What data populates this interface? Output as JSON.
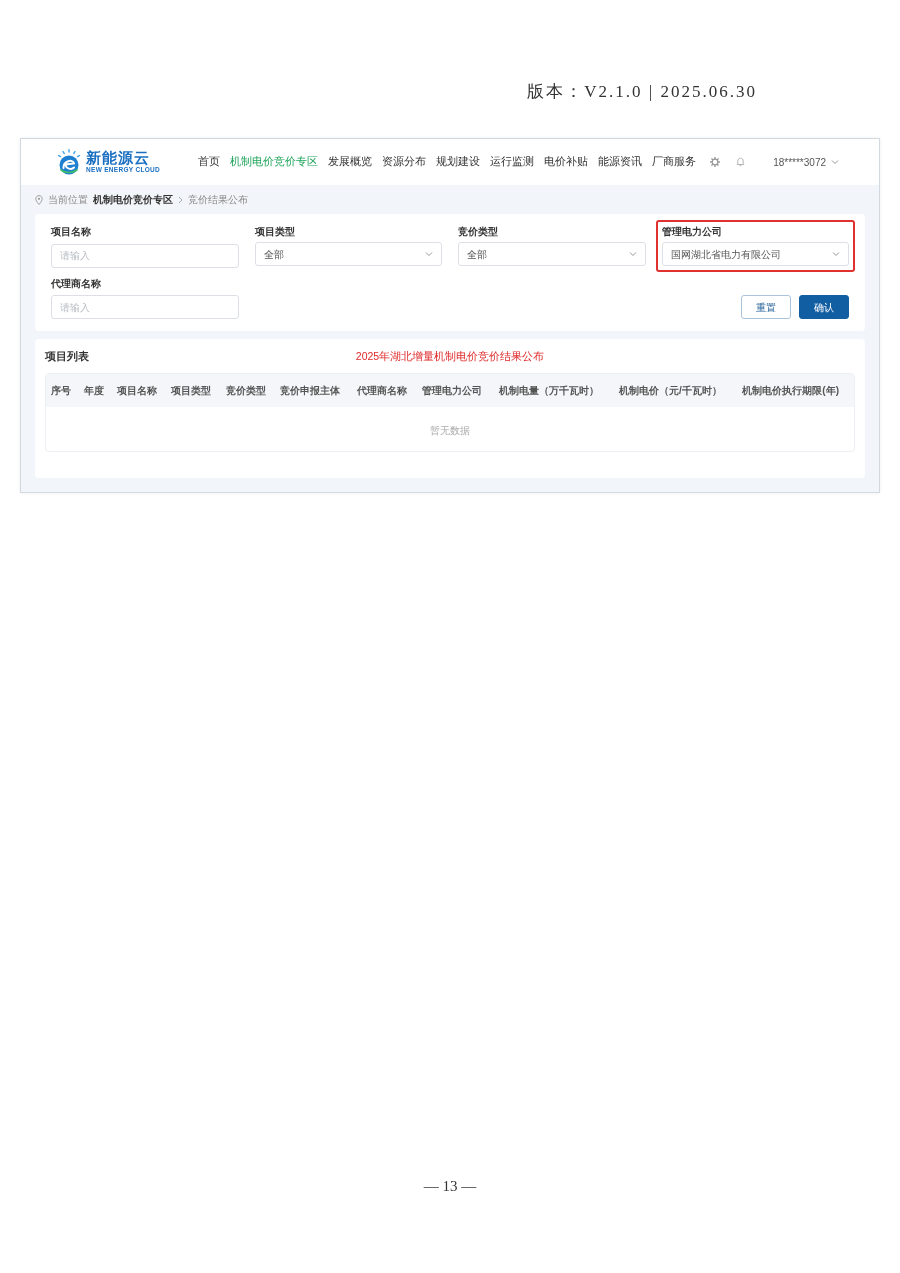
{
  "document": {
    "version": "版本：V2.1.0 | 2025.06.30",
    "page_number": "— 13 —"
  },
  "app": {
    "logo": {
      "title": "新能源云",
      "subtitle": "NEW ENERGY CLOUD"
    },
    "nav": [
      {
        "label": "首页",
        "selected": false
      },
      {
        "label": "机制电价竞价专区",
        "selected": true
      },
      {
        "label": "发展概览",
        "selected": false
      },
      {
        "label": "资源分布",
        "selected": false
      },
      {
        "label": "规划建设",
        "selected": false
      },
      {
        "label": "运行监测",
        "selected": false
      },
      {
        "label": "电价补贴",
        "selected": false
      },
      {
        "label": "能源资讯",
        "selected": false
      },
      {
        "label": "厂商服务",
        "selected": false
      }
    ],
    "user": "18*****3072",
    "breadcrumb": {
      "label": "当前位置",
      "items": [
        "机制电价竞价专区",
        "竞价结果公布"
      ]
    },
    "filters": [
      {
        "label": "项目名称",
        "kind": "input",
        "placeholder": "请输入",
        "highlighted": false
      },
      {
        "label": "项目类型",
        "kind": "select",
        "value": "全部",
        "highlighted": false
      },
      {
        "label": "竞价类型",
        "kind": "select",
        "value": "全部",
        "highlighted": false
      },
      {
        "label": "管理电力公司",
        "kind": "select",
        "value": "国网湖北省电力有限公司",
        "highlighted": true
      },
      {
        "label": "代理商名称",
        "kind": "input",
        "placeholder": "请输入",
        "highlighted": false
      }
    ],
    "buttons": [
      {
        "label": "重置",
        "kind": "secondary"
      },
      {
        "label": "确认",
        "kind": "primary"
      }
    ],
    "list": {
      "title": "项目列表",
      "notice": "2025年湖北增量机制电价竞价结果公布",
      "columns": [
        "序号",
        "年度",
        "项目名称",
        "项目类型",
        "竞价类型",
        "竞价申报主体",
        "代理商名称",
        "管理电力公司",
        "机制电量（万千瓦时）",
        "机制电价（元/千瓦时）",
        "机制电价执行期限(年)"
      ],
      "empty_text": "暂无数据"
    }
  }
}
